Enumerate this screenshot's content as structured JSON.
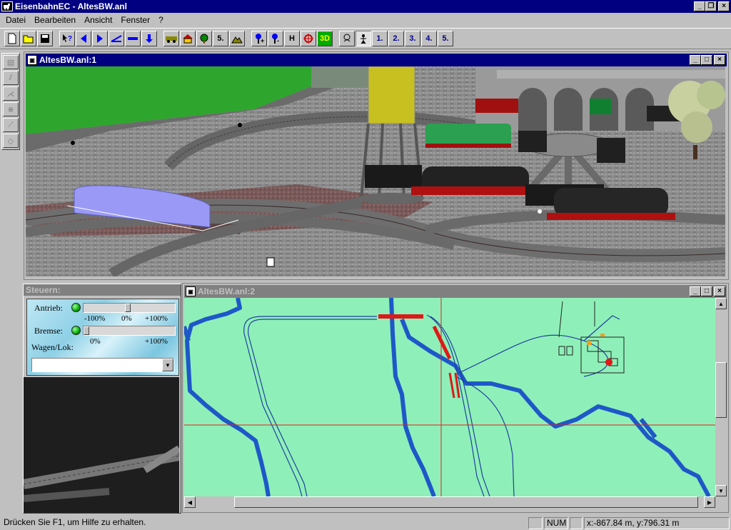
{
  "app": {
    "title": "EisenbahnEC - AltesBW.anl"
  },
  "menu": [
    "Datei",
    "Bearbeiten",
    "Ansicht",
    "Fenster",
    "?"
  ],
  "window3d": {
    "title": "AltesBW.anl:1"
  },
  "window2d": {
    "title": "AltesBW.anl:2"
  },
  "steuern": {
    "header": "Steuern:",
    "antrieb_label": "Antrieb:",
    "bremse_label": "Bremse:",
    "wagen_label": "Wagen/Lok:",
    "antrieb_ticks": [
      "-100%",
      "0%",
      "+100%"
    ],
    "bremse_ticks": [
      "0%",
      "+100%"
    ],
    "wagen_selected": ""
  },
  "toolbar_text": {
    "five_a": "5.",
    "h": "H",
    "three_d": "3D",
    "view1": "1.",
    "view2": "2.",
    "view3": "3.",
    "view4": "4.",
    "view5": "5."
  },
  "status": {
    "help": "Drücken Sie F1, um Hilfe zu erhalten.",
    "num": "NUM",
    "coords": "x:-867.84 m, y:796.31 m"
  },
  "colors": {
    "titlebar": "#000080",
    "map_bg": "#8ef0b8",
    "river": "#1e58c8",
    "track_red": "#e01818"
  }
}
